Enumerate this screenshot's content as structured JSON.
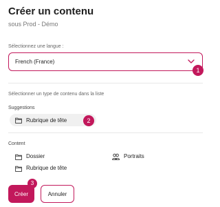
{
  "dialog": {
    "title": "Créer un contenu",
    "subtitle": "sous Prod - Démo"
  },
  "language": {
    "label": "Sélectionnez une langue :",
    "selected": "French (France)"
  },
  "content_type": {
    "label": "Sélectionner un type de contenu dans la liste"
  },
  "suggestions": {
    "title": "Suggestions",
    "items": [
      {
        "label": "Rubrique de tête",
        "icon": "folder-icon"
      }
    ]
  },
  "content": {
    "title": "Content",
    "items": [
      {
        "label": "Dossier",
        "icon": "folder-icon"
      },
      {
        "label": "Rubrique de tête",
        "icon": "folder-icon"
      },
      {
        "label": "Portraits",
        "icon": "people-icon"
      }
    ]
  },
  "actions": {
    "create_label": "Créer",
    "cancel_label": "Annuler"
  },
  "badges": [
    "1",
    "2",
    "3"
  ],
  "colors": {
    "accent": "#c2185b",
    "suggestion_bg": "#f0f0f0"
  }
}
